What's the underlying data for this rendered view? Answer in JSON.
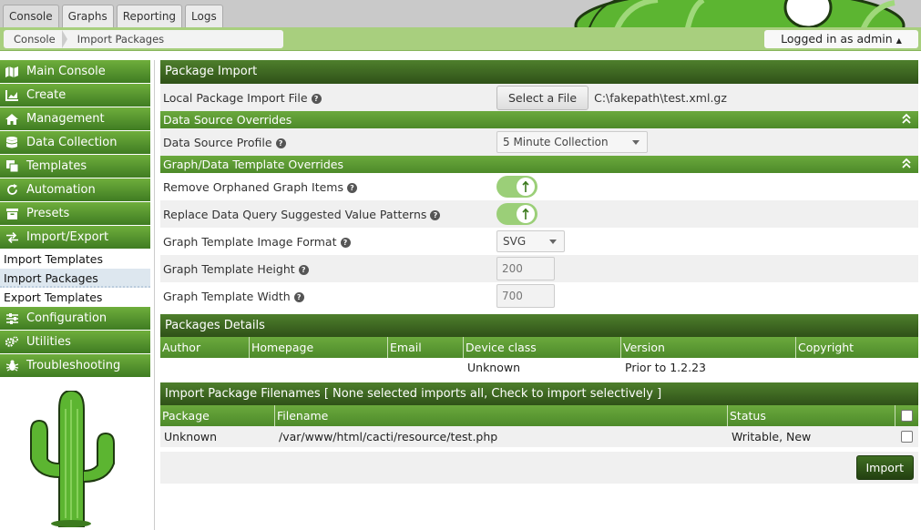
{
  "tabs": [
    "Console",
    "Graphs",
    "Reporting",
    "Logs"
  ],
  "breadcrumb": [
    "Console",
    "Import Packages"
  ],
  "user_label": "Logged in as admin",
  "sidebar": {
    "items": [
      {
        "label": "Main Console",
        "icon": "map-icon"
      },
      {
        "label": "Create",
        "icon": "chart-area-icon"
      },
      {
        "label": "Management",
        "icon": "home-icon"
      },
      {
        "label": "Data Collection",
        "icon": "database-icon"
      },
      {
        "label": "Templates",
        "icon": "copy-icon"
      },
      {
        "label": "Automation",
        "icon": "refresh-icon"
      },
      {
        "label": "Presets",
        "icon": "archive-icon"
      },
      {
        "label": "Import/Export",
        "icon": "exchange-icon"
      }
    ],
    "sub_items": [
      "Import Templates",
      "Import Packages",
      "Export Templates"
    ],
    "items_after": [
      {
        "label": "Configuration",
        "icon": "sliders-icon"
      },
      {
        "label": "Utilities",
        "icon": "cogs-icon"
      },
      {
        "label": "Troubleshooting",
        "icon": "bug-icon"
      }
    ]
  },
  "main": {
    "title": "Package Import",
    "file_label": "Local Package Import File",
    "file_button": "Select a File",
    "file_value": "C:\\fakepath\\test.xml.gz",
    "ds_section": "Data Source Overrides",
    "ds_profile_label": "Data Source Profile",
    "ds_profile_value": "5 Minute Collection",
    "gt_section": "Graph/Data Template Overrides",
    "remove_orphaned_label": "Remove Orphaned Graph Items",
    "replace_dq_label": "Replace Data Query Suggested Value Patterns",
    "image_format_label": "Graph Template Image Format",
    "image_format_value": "SVG",
    "height_label": "Graph Template Height",
    "height_value": "200",
    "width_label": "Graph Template Width",
    "width_value": "700",
    "details_title": "Packages Details",
    "details_columns": [
      "Author",
      "Homepage",
      "Email",
      "Device class",
      "Version",
      "Copyright"
    ],
    "details_row": [
      "",
      "",
      "",
      "Unknown",
      "Prior to 1.2.23",
      ""
    ],
    "filenames_title": "Import Package Filenames [ None selected imports all, Check to import selectively ]",
    "filenames_columns": [
      "Package",
      "Filename",
      "Status"
    ],
    "filenames_row": [
      "Unknown",
      "/var/www/html/cacti/resource/test.php",
      "Writable, New"
    ],
    "import_button": "Import"
  },
  "colors": {
    "accent_dark": "#2f5118",
    "accent": "#4d8a2a",
    "toggle_on": "#9bcf78",
    "cactus": "#5cb531"
  }
}
